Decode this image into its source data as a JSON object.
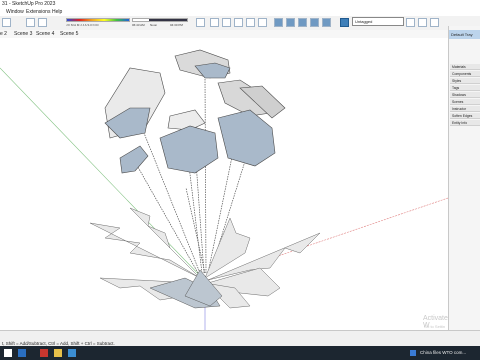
{
  "window": {
    "title": "31 - SketchUp Pro 2023"
  },
  "menu": [
    "Window",
    "Extensions",
    "Help"
  ],
  "toolbar": {
    "style_dropdown": "Untagged",
    "shadow_labels": [
      "J F M A M J J A S O N D"
    ],
    "time_labels": [
      "06:43 AM",
      "Noon",
      "04:30 PM"
    ]
  },
  "tabs": [
    "e 2",
    "Scene 3",
    "Scene 4",
    "Scene 5"
  ],
  "tray": {
    "title": "Default Tray",
    "items": [
      "Materials",
      "Components",
      "Styles",
      "Tags",
      "Shadows",
      "Scenes",
      "Instructor",
      "Soften Edges",
      "Entity Info"
    ]
  },
  "viewport": {
    "watermark_main": "Activate W",
    "watermark_sub": "Go to Settin"
  },
  "status": {
    "message": "t, Shift = Add/Subtract, Ctrl = Add, Shift + Ctrl = Subtract."
  },
  "taskbar": {
    "news": "China files WTO com..."
  },
  "colors": {
    "toolbar_accent": "#3d7eb8",
    "tray_header": "#bcd4ec",
    "taskbar": "#1c2630"
  }
}
